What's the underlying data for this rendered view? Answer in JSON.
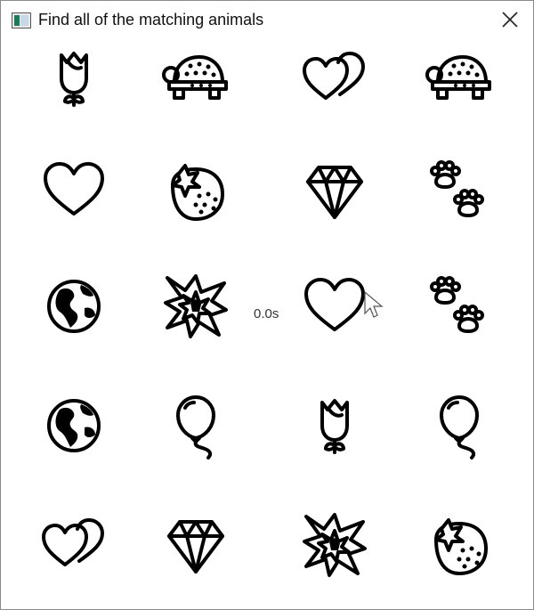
{
  "window": {
    "title": "Find all of the matching animals",
    "icon": "app-window-icon",
    "close_icon": "close-icon"
  },
  "timer": {
    "text": "0.0s"
  },
  "grid": {
    "rows": 5,
    "cols": 4,
    "tiles": [
      [
        "rose",
        "turtle",
        "two-hearts",
        "turtle"
      ],
      [
        "heart",
        "strawberry",
        "gem",
        "paw-prints"
      ],
      [
        "globe",
        "collision",
        "heart",
        "paw-prints"
      ],
      [
        "globe",
        "balloon",
        "rose",
        "balloon"
      ],
      [
        "two-hearts",
        "gem",
        "collision",
        "strawberry"
      ]
    ]
  },
  "colors": {
    "stroke": "#000000",
    "background": "#ffffff"
  }
}
